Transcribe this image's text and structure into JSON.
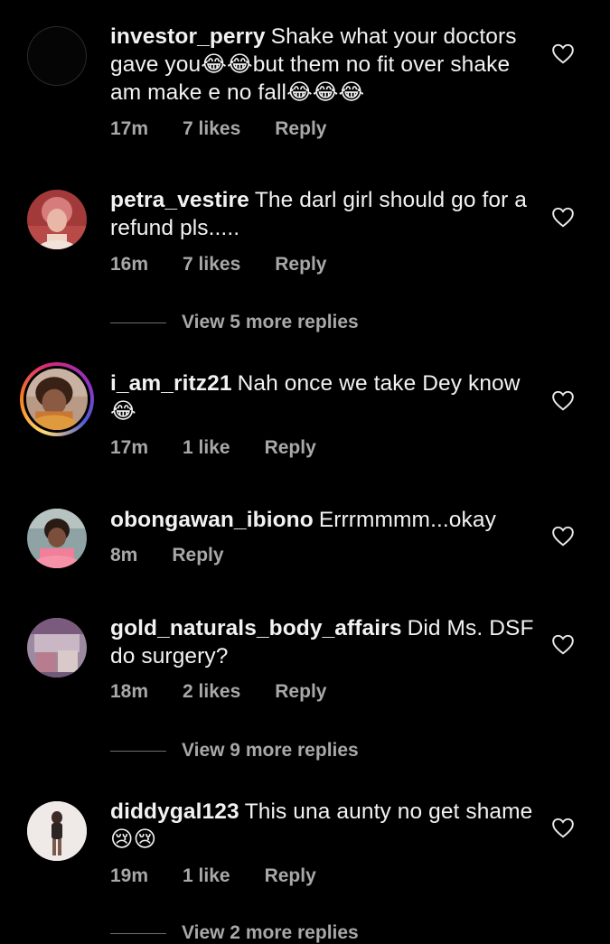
{
  "comments": [
    {
      "username": "investor_perry",
      "text": "Shake what your doctors gave you😂😂but them no fit over shake am make e no fall😂😂😂",
      "time": "17m",
      "likes": "7 likes",
      "reply": "Reply"
    },
    {
      "username": "petra_vestire",
      "text": "The darl girl should go for a refund pls.....",
      "time": "16m",
      "likes": "7 likes",
      "reply": "Reply",
      "view_replies": "View 5 more replies"
    },
    {
      "username": "i_am_ritz21",
      "text": "Nah once we take Dey know 😂",
      "time": "17m",
      "likes": "1 like",
      "reply": "Reply"
    },
    {
      "username": "obongawan_ibiono",
      "text": "Errrmmmm...okay",
      "time": "8m",
      "reply": "Reply"
    },
    {
      "username": "gold_naturals_body_affairs",
      "text": "Did Ms. DSF do surgery?",
      "time": "18m",
      "likes": "2 likes",
      "reply": "Reply",
      "view_replies": "View 9 more replies"
    },
    {
      "username": "diddygal123",
      "text": "This una aunty no get shame 😢😢",
      "time": "19m",
      "likes": "1 like",
      "reply": "Reply",
      "view_replies": "View 2 more replies"
    }
  ],
  "icons": {
    "like": "heart-outline-icon"
  },
  "colors": {
    "background": "#000000",
    "text": "#f2f2f2",
    "meta": "#a8a8a8",
    "story_ring": [
      "#feda75",
      "#fa7e1e",
      "#d62976",
      "#962fbf"
    ]
  }
}
